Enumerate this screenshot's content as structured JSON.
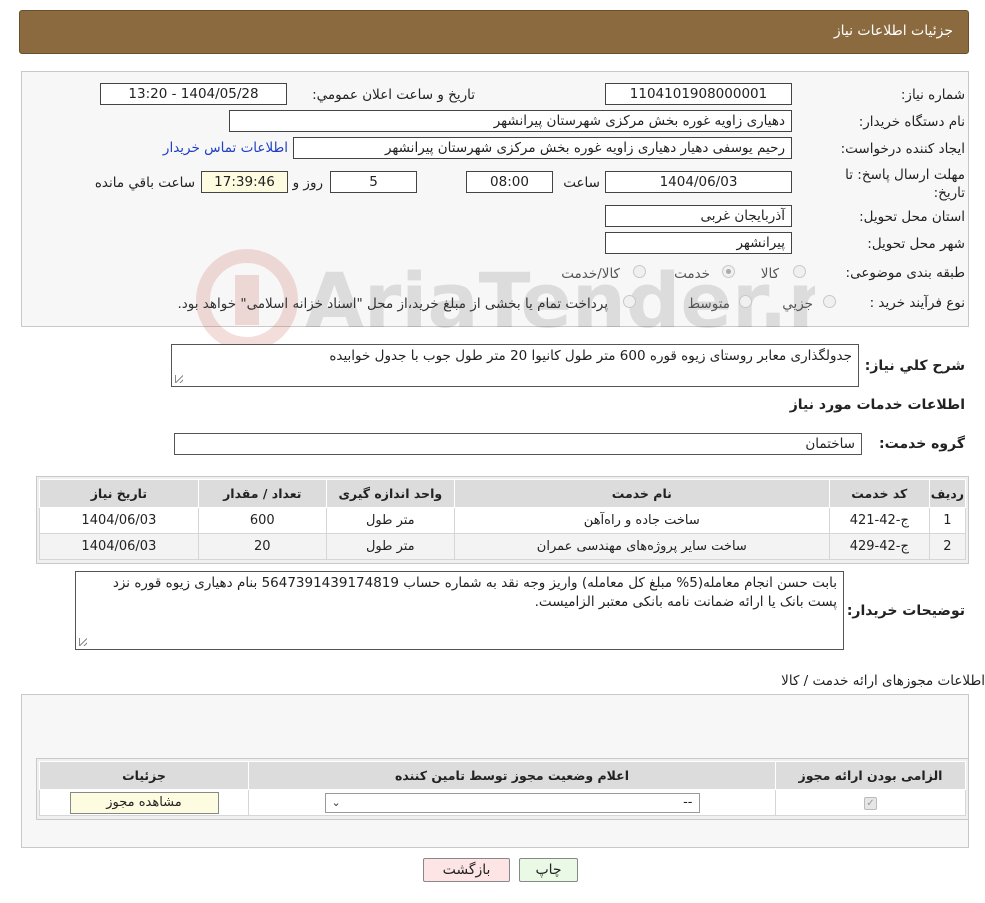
{
  "header": {
    "title": "جزئیات اطلاعات نیاز"
  },
  "form": {
    "need_number_label": "شماره نیاز:",
    "need_number": "1104101908000001",
    "announce_label": "تاریخ و ساعت اعلان عمومي:",
    "announce_value": "1404/05/28 - 13:20",
    "buyer_org_label": "نام دستگاه خريدار:",
    "buyer_org": "دهیاری زاویه غوره بخش مرکزی شهرستان پیرانشهر",
    "creator_label": "ايجاد کننده درخواست:",
    "creator": "رحیم یوسفی دهیار دهیاری زاویه غوره بخش مرکزی شهرستان پیرانشهر",
    "contact_link": "اطلاعات تماس خريدار",
    "deadline_label": "مهلت ارسال پاسخ: تا تاریخ:",
    "deadline_date": "1404/06/03",
    "time_label": "ساعت",
    "deadline_time": "08:00",
    "days_value": "5",
    "days_label": "روز و",
    "remaining_time": "17:39:46",
    "remaining_label": "ساعت باقي مانده",
    "province_label": "استان محل تحویل:",
    "province": "آذربایجان غربی",
    "city_label": "شهر محل تحویل:",
    "city": "پیرانشهر",
    "category_label": "طبقه بندی موضوعی:",
    "category_options": [
      "کالا",
      "خدمت",
      "کالا/خدمت"
    ],
    "process_label": "نوع فرآیند خرید :",
    "process_options": [
      "جزیي",
      "متوسط"
    ],
    "process_note": "پرداخت تمام یا بخشی از مبلغ خرید،از محل \"اسناد خزانه اسلامی\" خواهد بود."
  },
  "description": {
    "label": "شرح کلي نياز:",
    "text": "جدولگذاری معابر روستای زیوه قوره 600 متر طول کانیوا 20 متر طول جوب با جدول خوابیده"
  },
  "services": {
    "section_title": "اطلاعات خدمات مورد نياز",
    "group_label": "گروه خدمت:",
    "group_value": "ساختمان",
    "columns": [
      "رديف",
      "کد خدمت",
      "نام خدمت",
      "واحد اندازه گيری",
      "تعداد / مقدار",
      "تاريخ نياز"
    ],
    "rows": [
      [
        "1",
        "ج-42-421",
        "ساخت جاده و راه‌آهن",
        "متر طول",
        "600",
        "1404/06/03"
      ],
      [
        "2",
        "ج-42-429",
        "ساخت سایر پروژه‌های مهندسی عمران",
        "متر طول",
        "20",
        "1404/06/03"
      ]
    ]
  },
  "buyer_notes": {
    "label": "توضيحات خريدار:",
    "text": "بابت حسن انجام معامله(5% مبلغ کل معامله) واریز وجه نقد به شماره حساب 5647391439174819 بنام دهیاری زیوه قوره نزد پست بانک یا ارائه ضمانت نامه بانکی معتبر الزامیست."
  },
  "permits": {
    "section_title": "اطلاعات مجوزهای ارائه خدمت / کالا",
    "columns": [
      "الزامی بودن ارائه مجوز",
      "اعلام وضعیت مجوز توسط تامین کننده",
      "جزئيات"
    ],
    "select_value": "--",
    "view_button": "مشاهده مجوز"
  },
  "actions": {
    "print": "چاپ",
    "back": "بازگشت"
  },
  "watermark": {
    "text": "AriaTender.neT"
  },
  "colors": {
    "header": "#8a6a3e",
    "link": "#1f3fc7",
    "back_button": "#fde5e5",
    "print_button": "#eaf9e6"
  }
}
